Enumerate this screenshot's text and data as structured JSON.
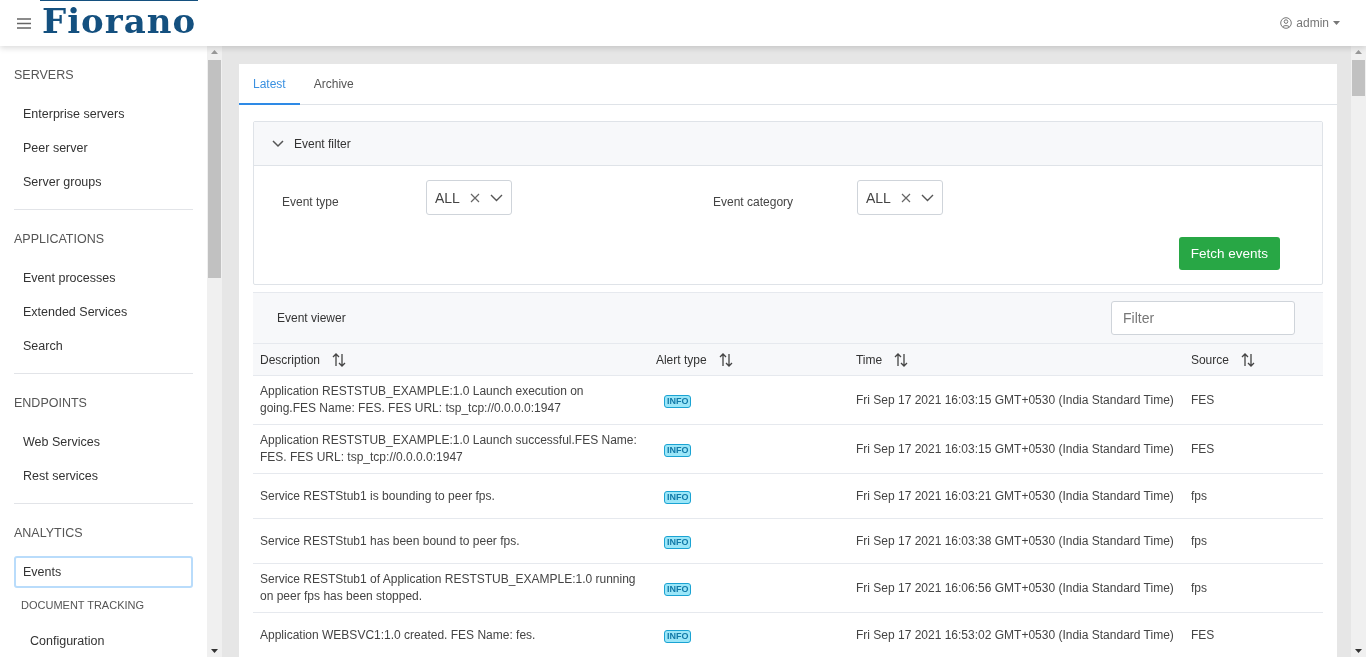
{
  "header": {
    "logo": "Fiorano",
    "user": "admin"
  },
  "sidebar": {
    "sections": [
      {
        "heading": "SERVERS",
        "items": [
          {
            "kind": "item",
            "label": "Enterprise servers",
            "selected": false
          },
          {
            "kind": "item",
            "label": "Peer server",
            "selected": false
          },
          {
            "kind": "item",
            "label": "Server groups",
            "selected": false
          }
        ]
      },
      {
        "heading": "APPLICATIONS",
        "items": [
          {
            "kind": "item",
            "label": "Event processes",
            "selected": false
          },
          {
            "kind": "item",
            "label": "Extended Services",
            "selected": false
          },
          {
            "kind": "item",
            "label": "Search",
            "selected": false
          }
        ]
      },
      {
        "heading": "ENDPOINTS",
        "items": [
          {
            "kind": "item",
            "label": "Web Services",
            "selected": false
          },
          {
            "kind": "item",
            "label": "Rest services",
            "selected": false
          }
        ]
      },
      {
        "heading": "ANALYTICS",
        "items": [
          {
            "kind": "item",
            "label": "Events",
            "selected": true
          },
          {
            "kind": "group",
            "label": "DOCUMENT TRACKING",
            "children": [
              {
                "label": "Configuration",
                "selected": false
              }
            ]
          }
        ]
      }
    ]
  },
  "tabs": [
    {
      "label": "Latest",
      "selected": true
    },
    {
      "label": "Archive",
      "selected": false
    }
  ],
  "event_filter": {
    "title": "Event filter",
    "expanded": true,
    "fields": [
      {
        "label": "Event type",
        "value": "ALL"
      },
      {
        "label": "Event category",
        "value": "ALL"
      }
    ],
    "button": "Fetch events"
  },
  "event_viewer": {
    "title": "Event viewer",
    "filter_placeholder": "Filter",
    "columns": [
      "Description",
      "Alert type",
      "Time",
      "Source"
    ],
    "rows": [
      {
        "description": "Application RESTSTUB_EXAMPLE:1.0 Launch execution on going.FES Name: FES. FES URL: tsp_tcp://0.0.0.0:1947",
        "alert": "INFO",
        "time": "Fri Sep 17 2021 16:03:15 GMT+0530 (India Standard Time)",
        "source": "FES"
      },
      {
        "description": "Application RESTSTUB_EXAMPLE:1.0 Launch successful.FES Name: FES. FES URL: tsp_tcp://0.0.0.0:1947",
        "alert": "INFO",
        "time": "Fri Sep 17 2021 16:03:15 GMT+0530 (India Standard Time)",
        "source": "FES"
      },
      {
        "description": "Service RESTStub1 is bounding to peer fps.",
        "alert": "INFO",
        "time": "Fri Sep 17 2021 16:03:21 GMT+0530 (India Standard Time)",
        "source": "fps"
      },
      {
        "description": "Service RESTStub1 has been bound to peer fps.",
        "alert": "INFO",
        "time": "Fri Sep 17 2021 16:03:38 GMT+0530 (India Standard Time)",
        "source": "fps"
      },
      {
        "description": "Service RESTStub1 of Application RESTSTUB_EXAMPLE:1.0 running on peer fps has been stopped.",
        "alert": "INFO",
        "time": "Fri Sep 17 2021 16:06:56 GMT+0530 (India Standard Time)",
        "source": "fps"
      },
      {
        "description": "Application WEBSVC1:1.0 created. FES Name: fes.",
        "alert": "INFO",
        "time": "Fri Sep 17 2021 16:53:02 GMT+0530 (India Standard Time)",
        "source": "FES"
      }
    ]
  }
}
